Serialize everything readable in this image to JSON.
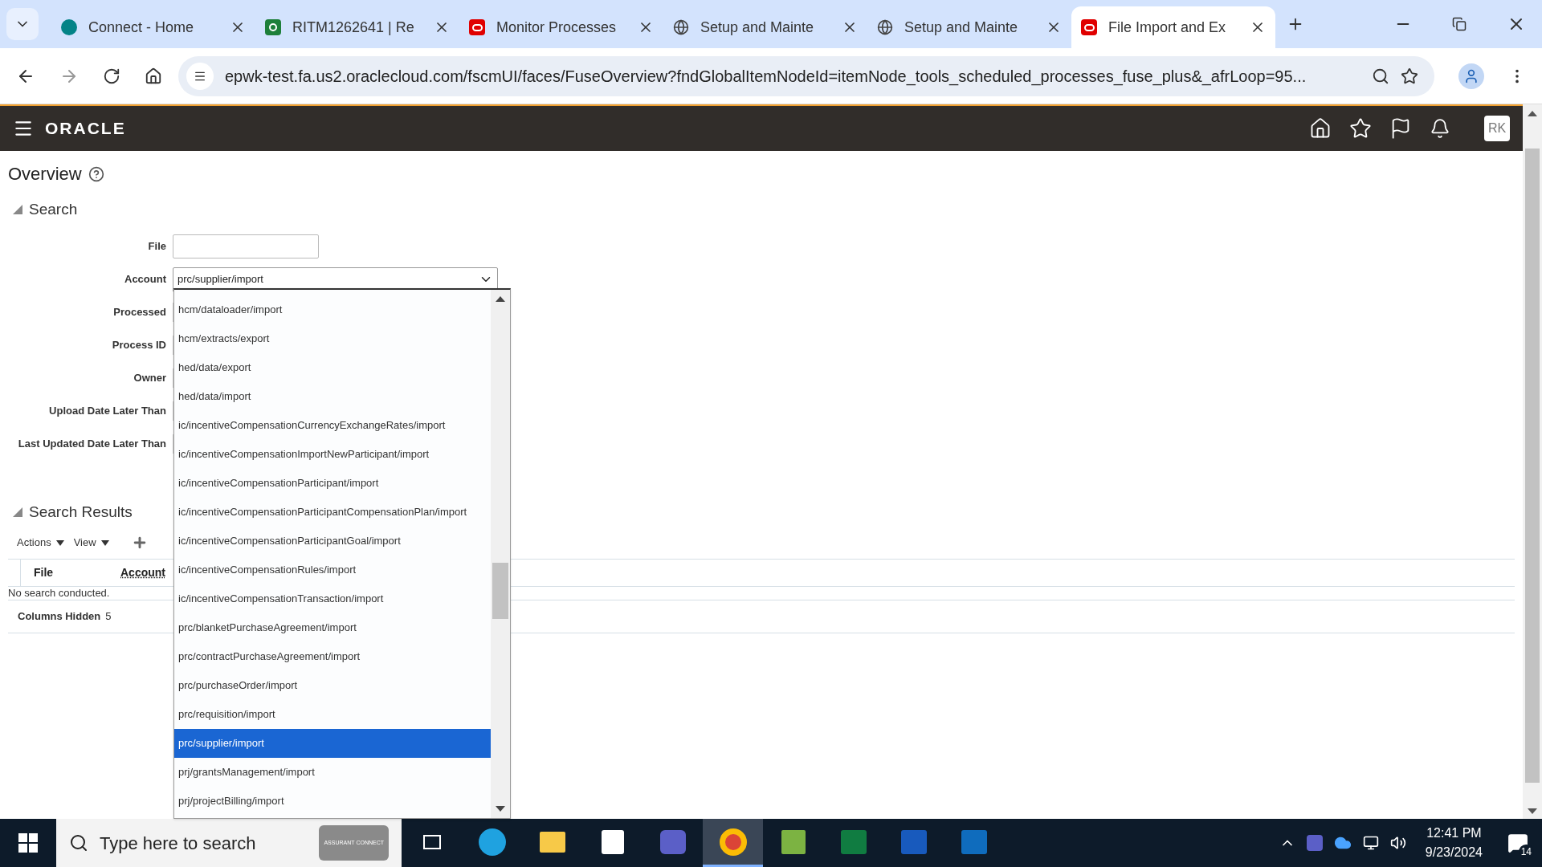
{
  "browser": {
    "tabs": [
      {
        "kind": "sharepoint",
        "title": "Connect - Home",
        "selected": false
      },
      {
        "kind": "servicenow",
        "title": "RITM1262641 | Re",
        "selected": false
      },
      {
        "kind": "oracle",
        "title": "Monitor Processes",
        "selected": false
      },
      {
        "kind": "globe",
        "title": "Setup and Mainte",
        "selected": false
      },
      {
        "kind": "globe",
        "title": "Setup and Mainte",
        "selected": false
      },
      {
        "kind": "oracle",
        "title": "File Import and Ex",
        "selected": true
      }
    ],
    "url": "epwk-test.fa.us2.oraclecloud.com/fscmUI/faces/FuseOverview?fndGlobalItemNodeId=itemNode_tools_scheduled_processes_fuse_plus&_afrLoop=95..."
  },
  "header": {
    "logo": "ORACLE",
    "avatar": "RK"
  },
  "page": {
    "title": "Overview",
    "search": {
      "heading": "Search",
      "expanded": true,
      "fields": [
        {
          "label": "File",
          "kind": "text"
        },
        {
          "label": "Account",
          "kind": "select",
          "value": "prc/supplier/import"
        },
        {
          "label": "Processed",
          "kind": "hidden"
        },
        {
          "label": "Process ID",
          "kind": "hidden"
        },
        {
          "label": "Owner",
          "kind": "hidden"
        },
        {
          "label": "Upload Date Later Than",
          "kind": "hidden"
        },
        {
          "label": "Last Updated Date Later Than",
          "kind": "hidden"
        }
      ]
    },
    "results": {
      "heading": "Search Results",
      "expanded": true,
      "menus": [
        "Actions",
        "View"
      ],
      "columns": [
        "File",
        "Account"
      ],
      "empty": "No search conducted.",
      "hidden_label": "Columns Hidden",
      "hidden_count": "5"
    },
    "dropdown": {
      "options": [
        {
          "label": "hcm/dataloader/import",
          "selected": false
        },
        {
          "label": "hcm/extracts/export",
          "selected": false
        },
        {
          "label": "hed/data/export",
          "selected": false
        },
        {
          "label": "hed/data/import",
          "selected": false
        },
        {
          "label": "ic/incentiveCompensationCurrencyExchangeRates/import",
          "selected": false
        },
        {
          "label": "ic/incentiveCompensationImportNewParticipant/import",
          "selected": false
        },
        {
          "label": "ic/incentiveCompensationParticipant/import",
          "selected": false
        },
        {
          "label": "ic/incentiveCompensationParticipantCompensationPlan/import",
          "selected": false
        },
        {
          "label": "ic/incentiveCompensationParticipantGoal/import",
          "selected": false
        },
        {
          "label": "ic/incentiveCompensationRules/import",
          "selected": false
        },
        {
          "label": "ic/incentiveCompensationTransaction/import",
          "selected": false
        },
        {
          "label": "prc/blanketPurchaseAgreement/import",
          "selected": false
        },
        {
          "label": "prc/contractPurchaseAgreement/import",
          "selected": false
        },
        {
          "label": "prc/purchaseOrder/import",
          "selected": false
        },
        {
          "label": "prc/requisition/import",
          "selected": false
        },
        {
          "label": "prc/supplier/import",
          "selected": true
        },
        {
          "label": "prj/grantsManagement/import",
          "selected": false
        },
        {
          "label": "prj/projectBilling/import",
          "selected": false
        }
      ]
    }
  },
  "taskbar": {
    "search_placeholder": "Type here to search",
    "search_badge": "ASSURANT CONNECT",
    "apps": [
      {
        "kind": "taskview",
        "selected": false
      },
      {
        "kind": "edge",
        "selected": false
      },
      {
        "kind": "explorer",
        "selected": false
      },
      {
        "kind": "store",
        "selected": false
      },
      {
        "kind": "teams",
        "selected": false
      },
      {
        "kind": "chrome",
        "selected": true
      },
      {
        "kind": "notepad",
        "selected": false
      },
      {
        "kind": "excel",
        "selected": false
      },
      {
        "kind": "word",
        "selected": false
      },
      {
        "kind": "outlook",
        "selected": false
      }
    ],
    "time": "12:41 PM",
    "date": "9/23/2024",
    "notifications": "14"
  }
}
